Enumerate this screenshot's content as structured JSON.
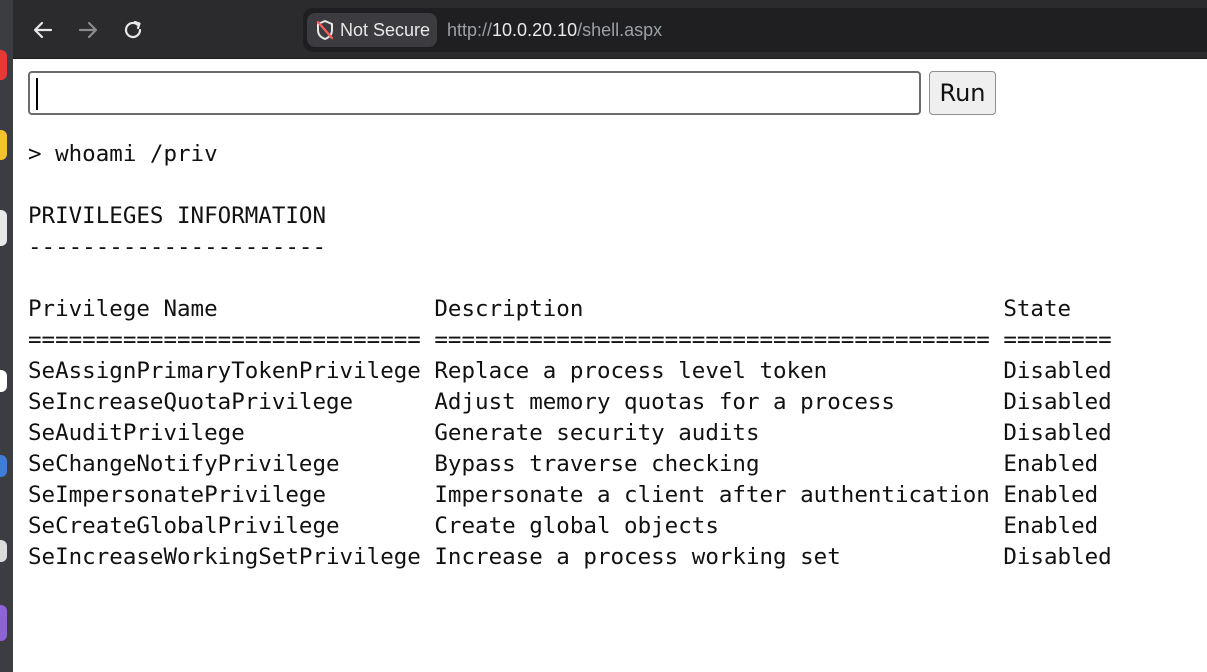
{
  "browser": {
    "security_label": "Not Secure",
    "url_scheme": "http://",
    "url_host": "10.0.20.10",
    "url_path": "/shell.aspx"
  },
  "shell": {
    "input_value": "",
    "run_label": "Run"
  },
  "output": {
    "command": "> whoami /priv",
    "heading": "PRIVILEGES INFORMATION",
    "heading_rule": "----------------------",
    "columns": [
      "Privilege Name",
      "Description",
      "State"
    ],
    "separators": [
      "=============================",
      "=========================================",
      "========"
    ],
    "rows": [
      {
        "name": "SeAssignPrimaryTokenPrivilege",
        "description": "Replace a process level token",
        "state": "Disabled"
      },
      {
        "name": "SeIncreaseQuotaPrivilege",
        "description": "Adjust memory quotas for a process",
        "state": "Disabled"
      },
      {
        "name": "SeAuditPrivilege",
        "description": "Generate security audits",
        "state": "Disabled"
      },
      {
        "name": "SeChangeNotifyPrivilege",
        "description": "Bypass traverse checking",
        "state": "Enabled"
      },
      {
        "name": "SeImpersonatePrivilege",
        "description": "Impersonate a client after authentication",
        "state": "Enabled"
      },
      {
        "name": "SeCreateGlobalPrivilege",
        "description": "Create global objects",
        "state": "Enabled"
      },
      {
        "name": "SeIncreaseWorkingSetPrivilege",
        "description": "Increase a process working set",
        "state": "Disabled"
      }
    ]
  },
  "colors": {
    "chrome_bg": "#2b2b2e",
    "urlbar_bg": "#1f1f21",
    "page_bg": "#ffffff"
  }
}
